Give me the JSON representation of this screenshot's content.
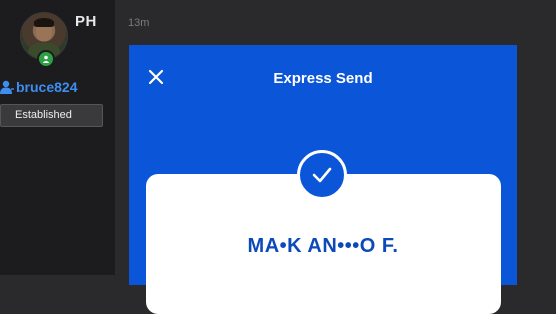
{
  "sidebar": {
    "initials": "PH",
    "username": "bruce824",
    "status": "Established",
    "colors": {
      "username": "#3d8ef0",
      "online": "#2ea043"
    }
  },
  "message": {
    "timestamp": "13m"
  },
  "express_send": {
    "title": "Express Send",
    "recipient": "MA•K AN•••O F.",
    "icons": {
      "close": "close-icon",
      "success": "checkmark-icon"
    },
    "colors": {
      "panel": "#0a55d8",
      "recipient_text": "#0b4ab8"
    }
  }
}
